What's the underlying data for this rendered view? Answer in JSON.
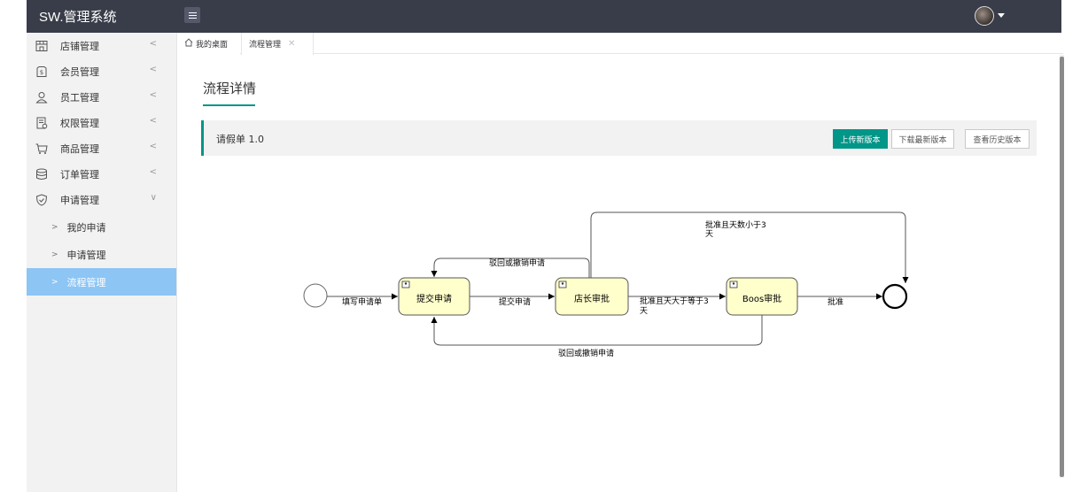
{
  "app": {
    "title": "SW.管理系统"
  },
  "sidebar": {
    "items": [
      {
        "label": "店铺管理",
        "icon": "store-icon"
      },
      {
        "label": "会员管理",
        "icon": "member-icon"
      },
      {
        "label": "员工管理",
        "icon": "staff-icon"
      },
      {
        "label": "权限管理",
        "icon": "permission-icon"
      },
      {
        "label": "商品管理",
        "icon": "cart-icon"
      },
      {
        "label": "订单管理",
        "icon": "database-icon"
      },
      {
        "label": "申请管理",
        "icon": "shield-icon"
      }
    ],
    "subitems": [
      {
        "label": "我的申请"
      },
      {
        "label": "申请管理"
      },
      {
        "label": "流程管理"
      }
    ]
  },
  "tabs": {
    "home": "我的桌面",
    "current": "流程管理"
  },
  "page": {
    "title": "流程详情",
    "process_name": "请假单 1.0",
    "buttons": {
      "upload": "上传新版本",
      "download": "下载最新版本",
      "history": "查看历史版本"
    },
    "colors": {
      "accent": "#009688",
      "topbar": "#393d49",
      "sidebar_active": "#8dc5f5",
      "task_fill": "#ffffcc"
    }
  },
  "diagram": {
    "tasks": {
      "submit": "提交申请",
      "manager": "店长审批",
      "boss": "Boos审批"
    },
    "labels": {
      "fill_form": "填写申请单",
      "submit_flow": "提交申请",
      "reject_top": "驳回或撤销申请",
      "reject_bottom": "驳回或撤销申请",
      "approve_ge3_line1": "批准且天大于等于3",
      "approve_ge3_line2": "天",
      "approve_lt3_line1": "批准且天数小于3",
      "approve_lt3_line2": "天",
      "approve": "批准"
    }
  }
}
